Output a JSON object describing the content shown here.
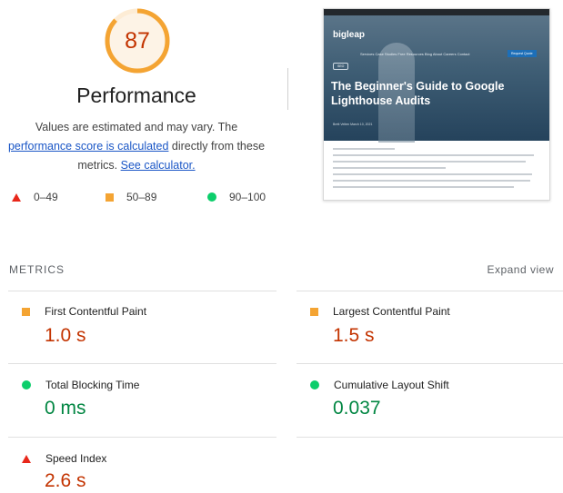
{
  "score": {
    "value": "87",
    "fraction": 0.87,
    "color": "#f4a433",
    "track_color": "#fdecd5"
  },
  "performance": {
    "title": "Performance",
    "desc_line1": "Values are estimated and may vary. The",
    "link_calc": "performance score is calculated",
    "desc_middle": " directly from these",
    "desc_line3_pre": "metrics. ",
    "link_calculator": "See calculator."
  },
  "legend": [
    {
      "shape": "triangle",
      "color": "#e8271a",
      "range": "0–49"
    },
    {
      "shape": "square",
      "color": "#f4a433",
      "range": "50–89"
    },
    {
      "shape": "circle",
      "color": "#0cce6b",
      "range": "90–100"
    }
  ],
  "screenshot": {
    "logo": "bigleap",
    "nav": "Services   Case Studies   Free Resources   Blog   About   Careers   Contact",
    "button": "Request Quote",
    "tag": "SEO",
    "headline": "The Beginner's Guide to Google Lighthouse Audits",
    "meta": "Brett Velten      March 10, 2021"
  },
  "metrics": {
    "heading": "METRICS",
    "expand": "Expand view",
    "items": [
      {
        "name": "First Contentful Paint",
        "value": "1.0 s",
        "status": "average"
      },
      {
        "name": "Largest Contentful Paint",
        "value": "1.5 s",
        "status": "average"
      },
      {
        "name": "Total Blocking Time",
        "value": "0 ms",
        "status": "pass"
      },
      {
        "name": "Cumulative Layout Shift",
        "value": "0.037",
        "status": "pass"
      },
      {
        "name": "Speed Index",
        "value": "2.6 s",
        "status": "fail"
      }
    ]
  }
}
